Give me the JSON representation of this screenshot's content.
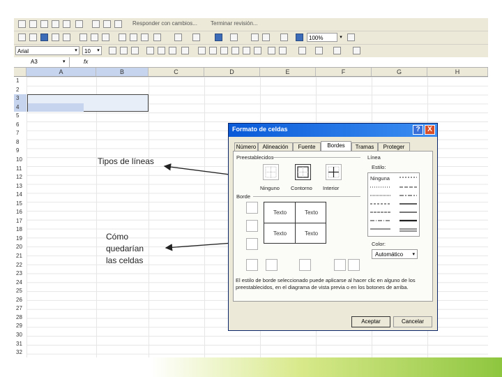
{
  "toolbar1": {
    "review_label": "Responder con cambios...",
    "end_review_label": "Terminar revisión..."
  },
  "toolbar2": {
    "zoom": "100%"
  },
  "toolbar3": {
    "font_name": "Arial",
    "font_size": "10"
  },
  "formula_bar": {
    "name_box": "A3",
    "fx_label": "fx"
  },
  "columns": [
    "A",
    "B",
    "C",
    "D",
    "E",
    "F",
    "G",
    "H"
  ],
  "rows": [
    "1",
    "2",
    "3",
    "4",
    "5",
    "6",
    "7",
    "8",
    "9",
    "10",
    "11",
    "12",
    "13",
    "14",
    "15",
    "16",
    "17",
    "18",
    "19",
    "20",
    "21",
    "22",
    "23",
    "24",
    "25",
    "26",
    "27",
    "28",
    "29",
    "30",
    "31",
    "32"
  ],
  "annotations": {
    "line_types": "Tipos de líneas",
    "cells_preview": "Cómo\nquedarían\nlas celdas"
  },
  "dialog": {
    "title": "Formato de celdas",
    "help": "?",
    "close": "X",
    "tabs": [
      "Número",
      "Alineación",
      "Fuente",
      "Bordes",
      "Tramas",
      "Proteger"
    ],
    "active_tab": "Bordes",
    "presets_label": "Preestablecidos",
    "preset_buttons": [
      "Ninguno",
      "Contorno",
      "Interior"
    ],
    "border_label": "Borde",
    "preview_cells": [
      "Texto",
      "Texto",
      "Texto",
      "Texto"
    ],
    "lines_label": "Línea",
    "style_label": "Estilo:",
    "style_none": "Ninguna",
    "color_label": "Color:",
    "color_value": "Automático",
    "hint": "El estilo de borde seleccionado puede aplicarse al hacer clic en alguno de los preestablecidos, en el diagrama de vista previa o en los botones de arriba.",
    "ok": "Aceptar",
    "cancel": "Cancelar"
  }
}
